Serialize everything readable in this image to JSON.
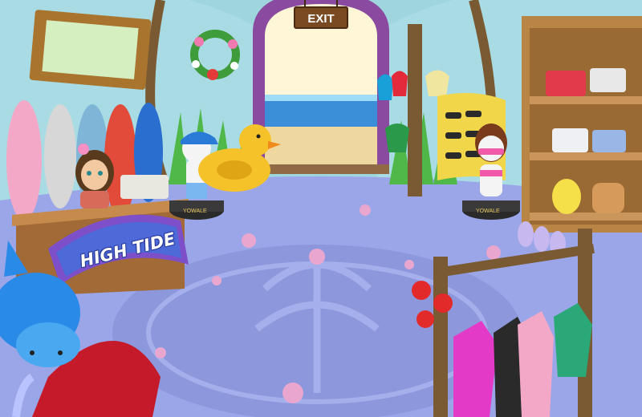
{
  "scene": {
    "exit_label": "EXIT",
    "sign_text": "HIGH TIDE",
    "mannequin_label": "YOWALE"
  },
  "colors": {
    "wall": "#9fd5dd",
    "floor": "#9aa6e8",
    "counter_sign": "#7d4fc9",
    "shelf_wood": "#b98545"
  }
}
